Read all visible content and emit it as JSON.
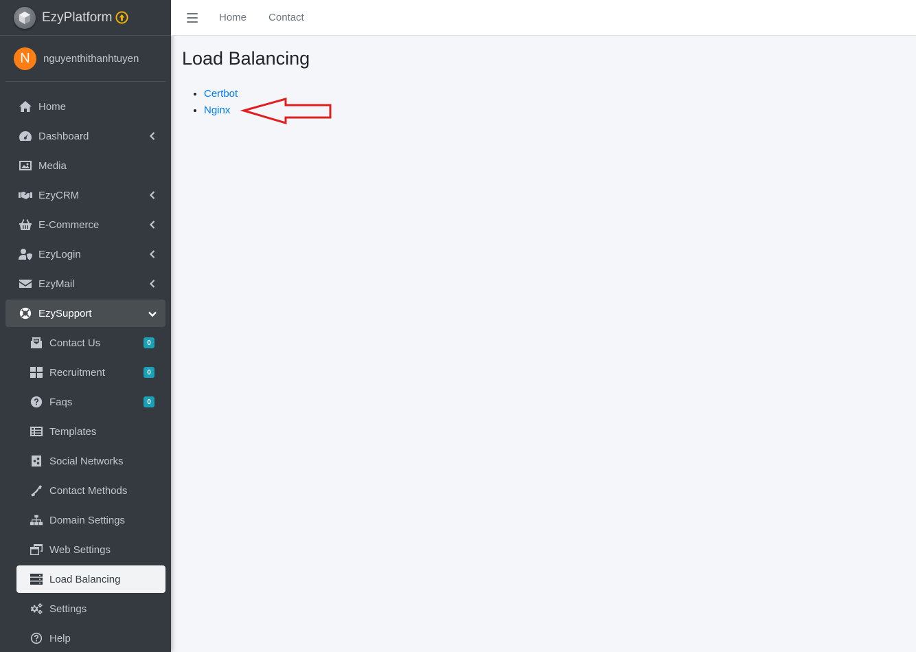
{
  "brand": {
    "name": "EzyPlatform",
    "logo_icon": "cube-logo-icon",
    "update_icon": "arrow-up-circle-icon",
    "update_color": "#f6b400"
  },
  "user": {
    "initial": "N",
    "name": "nguyenthithanhtuyen",
    "avatar_color": "#fd7e14"
  },
  "sidebar": {
    "items": [
      {
        "label": "Home",
        "icon": "home-icon"
      },
      {
        "label": "Dashboard",
        "icon": "tachometer-icon",
        "expandable": true
      },
      {
        "label": "Media",
        "icon": "image-icon"
      },
      {
        "label": "EzyCRM",
        "icon": "handshake-icon",
        "expandable": true
      },
      {
        "label": "E-Commerce",
        "icon": "basket-icon",
        "expandable": true
      },
      {
        "label": "EzyLogin",
        "icon": "user-shield-icon",
        "expandable": true
      },
      {
        "label": "EzyMail",
        "icon": "envelope-icon",
        "expandable": true
      },
      {
        "label": "EzySupport",
        "icon": "life-ring-icon",
        "expanded": true
      }
    ],
    "sub_items": [
      {
        "label": "Contact Us",
        "icon": "contact-icon",
        "badge": "0"
      },
      {
        "label": "Recruitment",
        "icon": "grid-icon",
        "badge": "0"
      },
      {
        "label": "Faqs",
        "icon": "question-circle-icon",
        "badge": "0"
      },
      {
        "label": "Templates",
        "icon": "table-list-icon"
      },
      {
        "label": "Social Networks",
        "icon": "share-square-icon"
      },
      {
        "label": "Contact Methods",
        "icon": "phone-icon"
      },
      {
        "label": "Domain Settings",
        "icon": "sitemap-icon"
      },
      {
        "label": "Web Settings",
        "icon": "window-restore-icon"
      },
      {
        "label": "Load Balancing",
        "icon": "server-icon",
        "active": true
      },
      {
        "label": "Settings",
        "icon": "cogs-icon"
      },
      {
        "label": "Help",
        "icon": "question-circle-outline-icon"
      }
    ]
  },
  "topbar": {
    "links": [
      "Home",
      "Contact"
    ]
  },
  "main": {
    "title": "Load Balancing",
    "links": [
      "Certbot",
      "Nginx"
    ],
    "annotation_color": "#e02020"
  }
}
